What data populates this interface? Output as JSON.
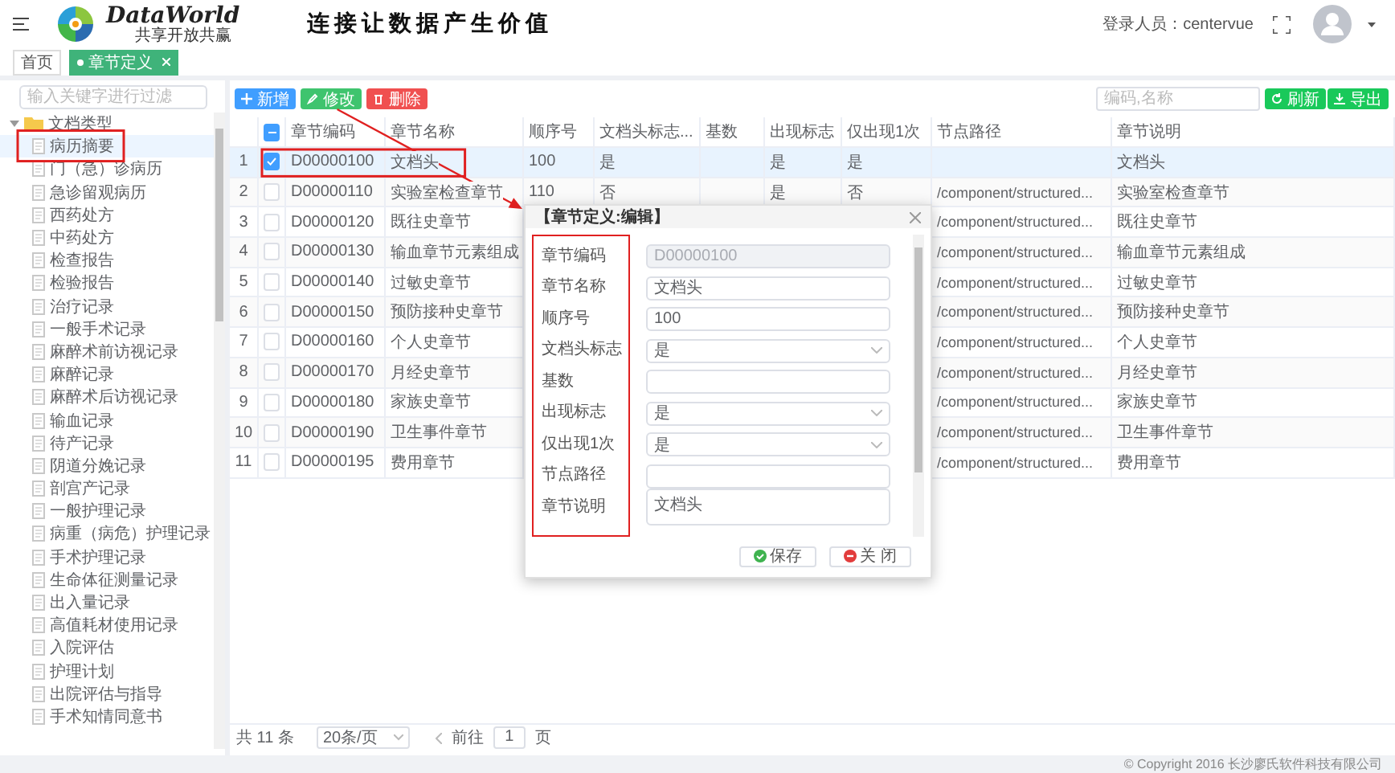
{
  "header": {
    "logo_title": "DataWorld",
    "logo_subtitle": "共享开放共赢",
    "slogan": "连接让数据产生价值",
    "user_label": "登录人员：centervue"
  },
  "tabs": [
    {
      "label": "首页",
      "selected": false,
      "closable": false
    },
    {
      "label": "章节定义",
      "selected": true,
      "closable": true
    }
  ],
  "sidebar": {
    "search_placeholder": "输入关键字进行过滤",
    "tree": [
      {
        "label": "文档类型",
        "expanded": true,
        "selected": false,
        "children": [
          {
            "label": "病历摘要",
            "selected": true
          },
          {
            "label": "门（急）诊病历",
            "selected": false
          },
          {
            "label": "急诊留观病历",
            "selected": false
          },
          {
            "label": "西药处方",
            "selected": false
          },
          {
            "label": "中药处方",
            "selected": false
          },
          {
            "label": "检查报告",
            "selected": false
          },
          {
            "label": "检验报告",
            "selected": false
          },
          {
            "label": "治疗记录",
            "selected": false
          },
          {
            "label": "一般手术记录",
            "selected": false
          },
          {
            "label": "麻醉术前访视记录",
            "selected": false
          },
          {
            "label": "麻醉记录",
            "selected": false
          },
          {
            "label": "麻醉术后访视记录",
            "selected": false
          },
          {
            "label": "输血记录",
            "selected": false
          },
          {
            "label": "待产记录",
            "selected": false
          },
          {
            "label": "阴道分娩记录",
            "selected": false
          },
          {
            "label": "剖宫产记录",
            "selected": false
          },
          {
            "label": "一般护理记录",
            "selected": false
          },
          {
            "label": "病重（病危）护理记录",
            "selected": false
          },
          {
            "label": "手术护理记录",
            "selected": false
          },
          {
            "label": "生命体征测量记录",
            "selected": false
          },
          {
            "label": "出入量记录",
            "selected": false
          },
          {
            "label": "高值耗材使用记录",
            "selected": false
          },
          {
            "label": "入院评估",
            "selected": false
          },
          {
            "label": "护理计划",
            "selected": false
          },
          {
            "label": "出院评估与指导",
            "selected": false
          },
          {
            "label": "手术知情同意书",
            "selected": false
          }
        ]
      }
    ]
  },
  "toolbar": {
    "buttons": [
      {
        "label": "新增",
        "kind": "add"
      },
      {
        "label": "修改",
        "kind": "edit"
      },
      {
        "label": "删除",
        "kind": "delete"
      }
    ],
    "search_placeholder": "编码,名称",
    "actions": [
      {
        "label": "刷新",
        "kind": "refresh"
      },
      {
        "label": "导出",
        "kind": "export"
      }
    ]
  },
  "table": {
    "select_all_indeterminate": true,
    "columns": [
      "章节编码",
      "章节名称",
      "顺序号",
      "文档头标志...",
      "基数",
      "出现标志",
      "仅出现1次",
      "节点路径",
      "章节说明"
    ],
    "rows": [
      {
        "index": "1",
        "checked": true,
        "selected": true,
        "code": "D00000100",
        "name": "文档头",
        "order": "100",
        "header_flag": "是",
        "appear": "是",
        "once_only": "是",
        "description": "文档头"
      },
      {
        "index": "2",
        "checked": false,
        "selected": false,
        "code": "D00000110",
        "name": "实验室检查章节",
        "order": "110",
        "header_flag": "否",
        "appear": "是",
        "once_only": "否",
        "path": "/component/structured...",
        "description": "实验室检查章节"
      },
      {
        "index": "3",
        "checked": false,
        "selected": false,
        "code": "D00000120",
        "name": "既往史章节",
        "path": "/component/structured...",
        "description": "既往史章节"
      },
      {
        "index": "4",
        "checked": false,
        "selected": false,
        "code": "D00000130",
        "name": "输血章节元素组成",
        "path": "/component/structured...",
        "description": "输血章节元素组成"
      },
      {
        "index": "5",
        "checked": false,
        "selected": false,
        "code": "D00000140",
        "name": "过敏史章节",
        "path": "/component/structured...",
        "description": "过敏史章节"
      },
      {
        "index": "6",
        "checked": false,
        "selected": false,
        "code": "D00000150",
        "name": "预防接种史章节",
        "path": "/component/structured...",
        "description": "预防接种史章节"
      },
      {
        "index": "7",
        "checked": false,
        "selected": false,
        "code": "D00000160",
        "name": "个人史章节",
        "path": "/component/structured...",
        "description": "个人史章节"
      },
      {
        "index": "8",
        "checked": false,
        "selected": false,
        "code": "D00000170",
        "name": "月经史章节",
        "path": "/component/structured...",
        "description": "月经史章节"
      },
      {
        "index": "9",
        "checked": false,
        "selected": false,
        "code": "D00000180",
        "name": "家族史章节",
        "path": "/component/structured...",
        "description": "家族史章节"
      },
      {
        "index": "10",
        "checked": false,
        "selected": false,
        "code": "D00000190",
        "name": "卫生事件章节",
        "path": "/component/structured...",
        "description": "卫生事件章节"
      },
      {
        "index": "11",
        "checked": false,
        "selected": false,
        "code": "D00000195",
        "name": "费用章节",
        "path": "/component/structured...",
        "description": "费用章节"
      }
    ]
  },
  "pagination": {
    "total": "共 11 条",
    "page_size": "20条/页",
    "goto_label": "前往",
    "page": "1",
    "page_suffix": "页"
  },
  "dialog": {
    "title": "【章节定义:编辑】",
    "fields": [
      {
        "label": "章节编码",
        "kind": "text",
        "value": "D00000100",
        "disabled": true
      },
      {
        "label": "章节名称",
        "kind": "text",
        "value": "文档头",
        "disabled": false
      },
      {
        "label": "顺序号",
        "kind": "text",
        "value": "100",
        "disabled": false
      },
      {
        "label": "文档头标志",
        "kind": "select",
        "value": "是",
        "disabled": false
      },
      {
        "label": "基数",
        "kind": "text",
        "disabled": false
      },
      {
        "label": "出现标志",
        "kind": "select",
        "value": "是",
        "disabled": false
      },
      {
        "label": "仅出现1次",
        "kind": "select",
        "value": "是",
        "disabled": false
      },
      {
        "label": "节点路径",
        "kind": "text",
        "disabled": false
      },
      {
        "label": "章节说明",
        "kind": "textarea",
        "value": "文档头",
        "disabled": false
      }
    ],
    "buttons": [
      {
        "label": "保存",
        "kind": "save"
      },
      {
        "label": "关 闭",
        "kind": "close"
      }
    ]
  },
  "footer": {
    "copyright": "© Copyright 2016 长沙廖氏软件科技有限公司"
  }
}
